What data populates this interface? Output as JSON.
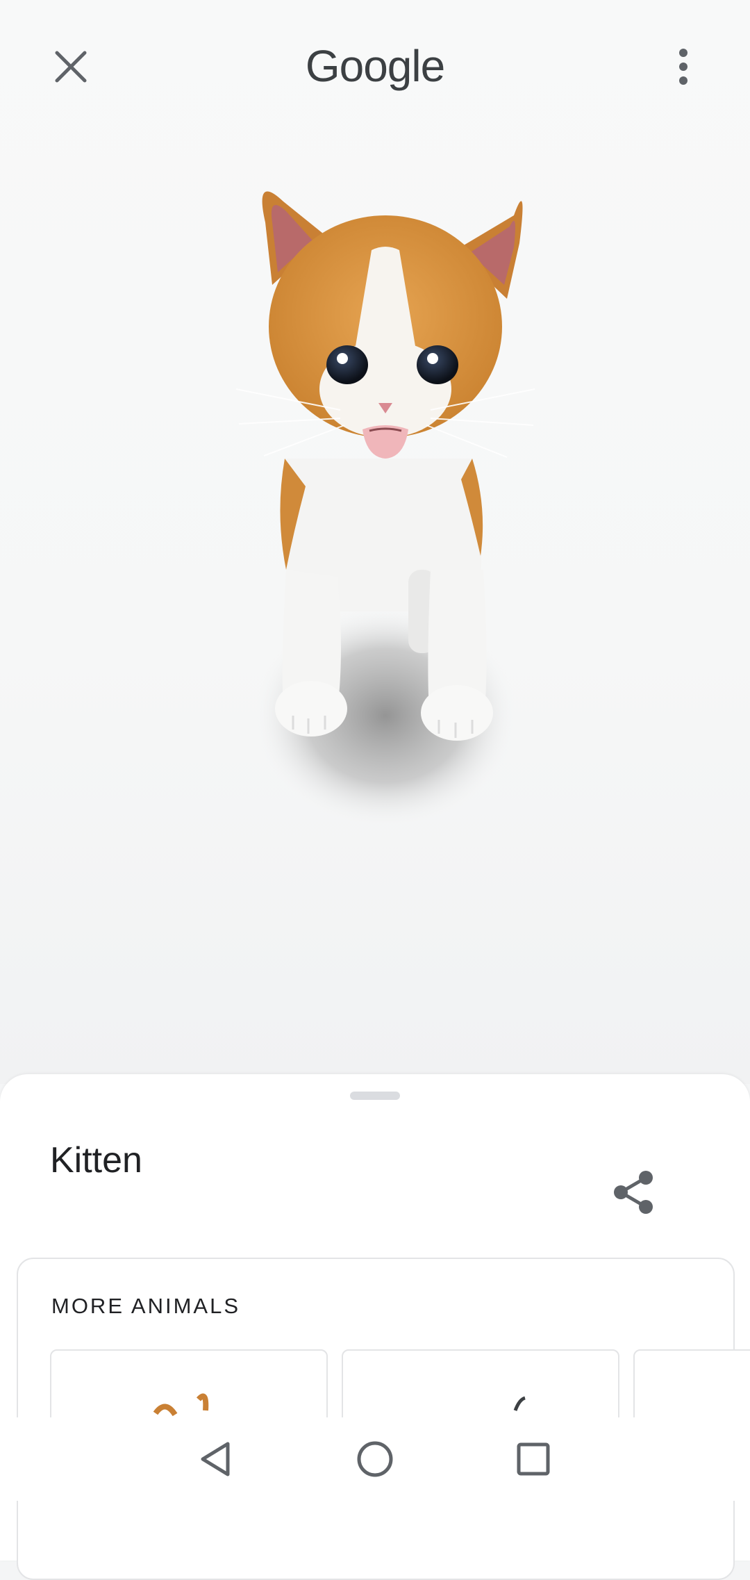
{
  "header": {
    "logo_text": "Google",
    "close_icon": "close-icon",
    "more_icon": "more-vert-icon"
  },
  "viewer": {
    "model": "kitten-3d-model"
  },
  "sheet": {
    "title": "Kitten",
    "share_icon": "share-icon",
    "more_animals": {
      "heading": "MORE ANIMALS"
    }
  },
  "navbar": {
    "back_icon": "back-triangle-icon",
    "home_icon": "home-circle-icon",
    "recent_icon": "recents-square-icon"
  },
  "colors": {
    "kitten_orange": "#d9913b",
    "kitten_white": "#f5f5f4",
    "icon_gray": "#5f6368"
  }
}
